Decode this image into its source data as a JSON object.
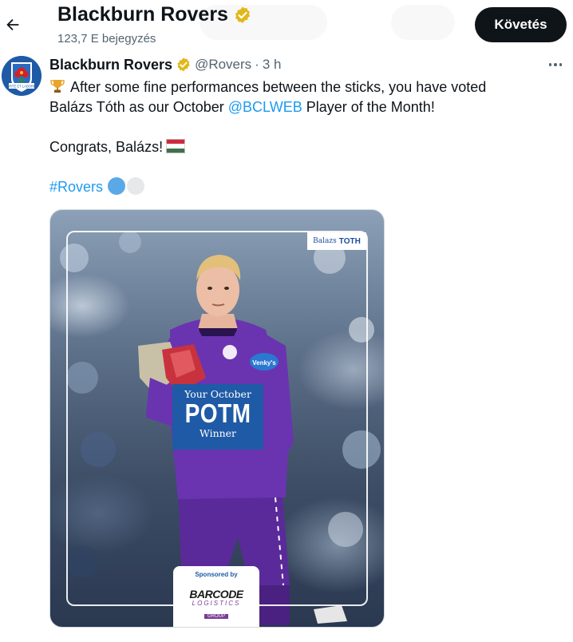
{
  "header": {
    "back_label": "Back",
    "name": "Blackburn Rovers",
    "post_count": "123,7 E bejegyzés",
    "follow_label": "Követés"
  },
  "post": {
    "author_name": "Blackburn Rovers",
    "handle": "@Rovers",
    "separator": "·",
    "time": "3 h",
    "text_line1": "After some fine performances between the sticks, you have voted",
    "text_line2_pre": "Balázs Tóth as our October ",
    "mention": "@BCLWEB",
    "text_line2_post": " Player of the Month!",
    "text_line3": "Congrats, Balázs!",
    "hashtag": "#Rovers",
    "avatar_motto": "ARTE ET LABORE",
    "icons": {
      "back": "arrow-left-icon",
      "verified": "verified-badge-icon",
      "more": "more-options-icon",
      "trophy": "trophy-emoji-icon",
      "flag": "hungary-flag-emoji-icon"
    },
    "colors": {
      "link": "#1d9bf0",
      "verified_gold": "#e2b719",
      "club_blue": "#1f5aa6",
      "hashflag_blue": "#5aa9e6",
      "hashflag_white": "#e6e8ea"
    },
    "media": {
      "name_tag_first": "Balazs",
      "name_tag_last": "TOTH",
      "potm_line1": "Your October",
      "potm_line2": "POTM",
      "potm_line3": "Winner",
      "sponsor_label": "Sponsored by",
      "sponsor_name": "BARCODE",
      "sponsor_sub": "LOGISTICS",
      "sponsor_group": "GROUP",
      "kit_sponsor": "Venky's"
    }
  }
}
